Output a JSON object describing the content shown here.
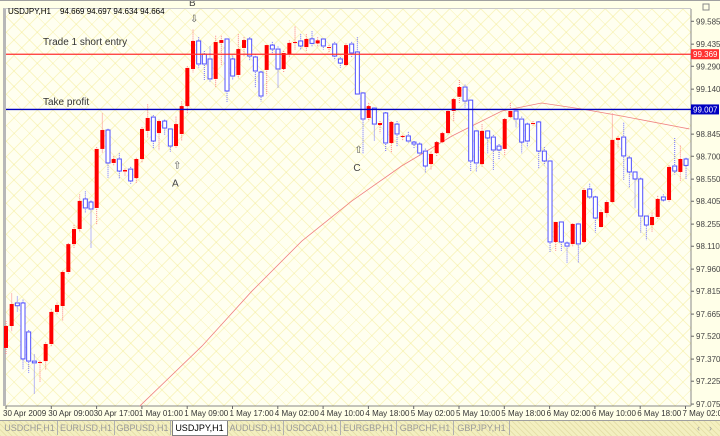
{
  "header": {
    "symbol": "USDJPY,H1",
    "ohlc": "94.669 94.697 94.634 94.664"
  },
  "annotations": {
    "trade_entry": "Trade 1 short entry",
    "take_profit": "Take profit",
    "a": "A",
    "b": "B",
    "c": "C"
  },
  "colors": {
    "bull": "#ff0000",
    "bear": "#5050ff",
    "entry_line": "#ff3030",
    "tp_line": "#0000c0",
    "ma": "#f08080"
  },
  "tabs": [
    {
      "label": "USDCHF,H1"
    },
    {
      "label": "EURUSD,H1"
    },
    {
      "label": "GBPUSD,H1"
    },
    {
      "label": "USDJPY,H1",
      "active": true
    },
    {
      "label": "AUDUSD,H1"
    },
    {
      "label": "USDCAD,H1"
    },
    {
      "label": "EURGBP,H1"
    },
    {
      "label": "GBPCHF,H1"
    },
    {
      "label": "GBPJPY,H1"
    }
  ],
  "chart_data": {
    "type": "candlestick",
    "ylim": [
      97.075,
      99.7
    ],
    "y_ticks": [
      "99.585",
      "99.435",
      "99.290",
      "99.140",
      "98.845",
      "98.700",
      "98.550",
      "98.405",
      "98.255",
      "98.110",
      "97.960",
      "97.815",
      "97.665",
      "97.520",
      "97.370",
      "97.225",
      "97.075"
    ],
    "x_ticks": [
      "30 Apr 2009",
      "30 Apr 09:00",
      "30 Apr 17:00",
      "1 May 01:00",
      "1 May 09:00",
      "1 May 17:00",
      "4 May 02:00",
      "4 May 10:00",
      "4 May 18:00",
      "5 May 02:00",
      "5 May 10:00",
      "5 May 18:00",
      "6 May 02:00",
      "6 May 10:00",
      "6 May 18:00",
      "7 May 02:00"
    ],
    "hlines": [
      {
        "name": "entry",
        "value": 99.369,
        "label": "99.369"
      },
      {
        "name": "take-profit",
        "value": 99.007,
        "label": "99.007"
      }
    ],
    "markers": [
      {
        "label": "A",
        "index": 30,
        "price": 98.62,
        "dir": "up"
      },
      {
        "label": "B",
        "index": 33,
        "price": 99.66,
        "dir": "down"
      },
      {
        "label": "C",
        "index": 62,
        "price": 98.72,
        "dir": "up"
      }
    ],
    "ma": [
      [
        23.6,
        97.062
      ],
      [
        34.6,
        97.456
      ],
      [
        43.4,
        97.816
      ],
      [
        52.2,
        98.144
      ],
      [
        61,
        98.406
      ],
      [
        69.8,
        98.636
      ],
      [
        78.7,
        98.833
      ],
      [
        87.5,
        98.997
      ],
      [
        94.5,
        99.049
      ],
      [
        101.6,
        99.01
      ],
      [
        108.6,
        98.964
      ],
      [
        120.6,
        98.879
      ]
    ],
    "candles": [
      [
        97.443,
        97.62,
        97.4,
        97.587
      ],
      [
        97.587,
        97.8,
        97.55,
        97.731
      ],
      [
        97.738,
        97.78,
        97.68,
        97.72
      ],
      [
        97.738,
        97.76,
        97.3,
        97.371
      ],
      [
        97.548,
        97.56,
        97.28,
        97.357
      ],
      [
        97.357,
        97.4,
        97.14,
        97.345
      ],
      [
        97.345,
        97.36,
        97.22,
        97.351
      ],
      [
        97.357,
        97.48,
        97.3,
        97.469
      ],
      [
        97.469,
        97.7,
        97.45,
        97.679
      ],
      [
        97.679,
        97.74,
        97.66,
        97.725
      ],
      [
        97.718,
        97.95,
        97.62,
        97.941
      ],
      [
        97.941,
        98.13,
        97.93,
        98.124
      ],
      [
        98.124,
        98.25,
        98.1,
        98.223
      ],
      [
        98.223,
        98.45,
        98.2,
        98.407
      ],
      [
        98.42,
        98.47,
        98.33,
        98.361
      ],
      [
        98.4,
        98.41,
        98.1,
        98.354
      ],
      [
        98.361,
        98.76,
        98.25,
        98.748
      ],
      [
        98.748,
        98.98,
        98.72,
        98.872
      ],
      [
        98.872,
        98.88,
        98.56,
        98.656
      ],
      [
        98.656,
        98.7,
        98.64,
        98.682
      ],
      [
        98.682,
        98.72,
        98.55,
        98.603
      ],
      [
        98.6,
        98.62,
        98.57,
        98.61
      ],
      [
        98.616,
        98.63,
        98.52,
        98.538
      ],
      [
        98.557,
        98.69,
        98.52,
        98.682
      ],
      [
        98.682,
        98.89,
        98.66,
        98.879
      ],
      [
        98.866,
        99.04,
        98.82,
        98.951
      ],
      [
        98.957,
        98.97,
        98.75,
        98.8
      ],
      [
        98.852,
        98.94,
        98.74,
        98.931
      ],
      [
        98.931,
        98.94,
        98.84,
        98.885
      ],
      [
        98.879,
        98.88,
        98.73,
        98.767
      ],
      [
        98.767,
        98.96,
        98.75,
        98.911
      ],
      [
        98.846,
        99.06,
        98.8,
        99.029
      ],
      [
        99.029,
        99.29,
        98.98,
        99.279
      ],
      [
        99.272,
        99.53,
        99.25,
        99.456
      ],
      [
        99.456,
        99.48,
        99.28,
        99.305
      ],
      [
        99.37,
        99.39,
        99.2,
        99.305
      ],
      [
        99.338,
        99.42,
        99.19,
        99.207
      ],
      [
        99.207,
        99.49,
        99.15,
        99.449
      ],
      [
        99.443,
        99.49,
        99.3,
        99.462
      ],
      [
        99.469,
        99.47,
        99.05,
        99.128
      ],
      [
        99.338,
        99.36,
        99.2,
        99.226
      ],
      [
        99.233,
        99.5,
        99.21,
        99.403
      ],
      [
        99.41,
        99.48,
        99.35,
        99.462
      ],
      [
        99.469,
        99.48,
        99.33,
        99.357
      ],
      [
        99.351,
        99.37,
        99.15,
        99.259
      ],
      [
        99.252,
        99.26,
        99.06,
        99.095
      ],
      [
        99.266,
        99.43,
        99.1,
        99.429
      ],
      [
        99.429,
        99.45,
        99.36,
        99.403
      ],
      [
        99.403,
        99.42,
        99.15,
        99.272
      ],
      [
        99.272,
        99.39,
        99.25,
        99.377
      ],
      [
        99.37,
        99.46,
        99.35,
        99.443
      ],
      [
        99.443,
        99.55,
        99.4,
        99.449
      ],
      [
        99.456,
        99.5,
        99.4,
        99.423
      ],
      [
        99.416,
        99.5,
        99.39,
        99.469
      ],
      [
        99.47,
        99.52,
        99.42,
        99.44
      ],
      [
        99.44,
        99.48,
        99.42,
        99.46
      ],
      [
        99.469,
        99.47,
        99.4,
        99.423
      ],
      [
        99.41,
        99.43,
        99.38,
        99.416
      ],
      [
        99.436,
        99.45,
        99.33,
        99.357
      ],
      [
        99.338,
        99.35,
        99.28,
        99.311
      ],
      [
        99.298,
        99.44,
        99.29,
        99.429
      ],
      [
        99.436,
        99.45,
        99.35,
        99.377
      ],
      [
        99.384,
        99.48,
        99.1,
        99.108
      ],
      [
        99.115,
        99.12,
        98.72,
        98.944
      ],
      [
        98.951,
        99.05,
        98.93,
        99.029
      ],
      [
        99.016,
        99.02,
        98.8,
        98.911
      ],
      [
        98.905,
        98.93,
        98.85,
        98.918
      ],
      [
        98.984,
        98.99,
        98.73,
        98.787
      ],
      [
        98.787,
        98.93,
        98.72,
        98.925
      ],
      [
        98.911,
        98.93,
        98.76,
        98.846
      ],
      [
        98.826,
        98.84,
        98.8,
        98.833
      ],
      [
        98.833,
        98.86,
        98.79,
        98.8
      ],
      [
        98.793,
        98.8,
        98.75,
        98.78
      ],
      [
        98.78,
        98.79,
        98.7,
        98.721
      ],
      [
        98.734,
        98.75,
        98.59,
        98.636
      ],
      [
        98.649,
        98.73,
        98.61,
        98.715
      ],
      [
        98.721,
        98.8,
        98.7,
        98.793
      ],
      [
        98.793,
        98.86,
        98.78,
        98.852
      ],
      [
        98.852,
        99.0,
        98.84,
        98.997
      ],
      [
        98.997,
        99.08,
        98.93,
        99.075
      ],
      [
        99.09,
        99.2,
        99.05,
        99.154
      ],
      [
        99.154,
        99.17,
        99.02,
        99.062
      ],
      [
        99.068,
        99.07,
        98.6,
        98.669
      ],
      [
        98.866,
        98.87,
        98.6,
        98.656
      ],
      [
        98.649,
        98.91,
        98.63,
        98.866
      ],
      [
        98.866,
        98.87,
        98.72,
        98.82
      ],
      [
        98.826,
        98.84,
        98.61,
        98.741
      ],
      [
        98.767,
        98.78,
        98.68,
        98.741
      ],
      [
        98.748,
        98.95,
        98.7,
        98.944
      ],
      [
        98.957,
        99.05,
        98.95,
        98.997
      ],
      [
        98.997,
        99.0,
        98.89,
        98.944
      ],
      [
        98.944,
        98.96,
        98.72,
        98.793
      ],
      [
        98.911,
        98.92,
        98.76,
        98.8
      ],
      [
        98.911,
        98.93,
        98.9,
        98.918
      ],
      [
        98.925,
        98.93,
        98.62,
        98.734
      ],
      [
        98.734,
        98.76,
        98.64,
        98.669
      ],
      [
        98.669,
        98.67,
        98.07,
        98.138
      ],
      [
        98.138,
        98.27,
        98.08,
        98.269
      ],
      [
        98.269,
        98.27,
        98.08,
        98.138
      ],
      [
        98.131,
        98.14,
        98.0,
        98.111
      ],
      [
        98.125,
        98.26,
        98.11,
        98.256
      ],
      [
        98.256,
        98.26,
        98.0,
        98.125
      ],
      [
        98.138,
        98.49,
        98.13,
        98.479
      ],
      [
        98.485,
        98.52,
        98.42,
        98.433
      ],
      [
        98.433,
        98.44,
        98.2,
        98.295
      ],
      [
        98.236,
        98.35,
        98.23,
        98.334
      ],
      [
        98.328,
        98.41,
        98.3,
        98.4
      ],
      [
        98.4,
        98.98,
        98.39,
        98.807
      ],
      [
        98.807,
        98.83,
        98.75,
        98.82
      ],
      [
        98.826,
        98.92,
        98.54,
        98.702
      ],
      [
        98.689,
        98.7,
        98.49,
        98.597
      ],
      [
        98.597,
        98.6,
        98.36,
        98.551
      ],
      [
        98.551,
        98.56,
        98.2,
        98.308
      ],
      [
        98.308,
        98.31,
        98.15,
        98.249
      ],
      [
        98.249,
        98.33,
        98.2,
        98.302
      ],
      [
        98.302,
        98.44,
        98.29,
        98.42
      ],
      [
        98.433,
        98.45,
        98.4,
        98.413
      ],
      [
        98.413,
        98.64,
        98.4,
        98.63
      ],
      [
        98.636,
        98.82,
        98.58,
        98.603
      ],
      [
        98.597,
        98.77,
        98.54,
        98.682
      ],
      [
        98.682,
        98.69,
        98.55,
        98.64
      ]
    ]
  }
}
